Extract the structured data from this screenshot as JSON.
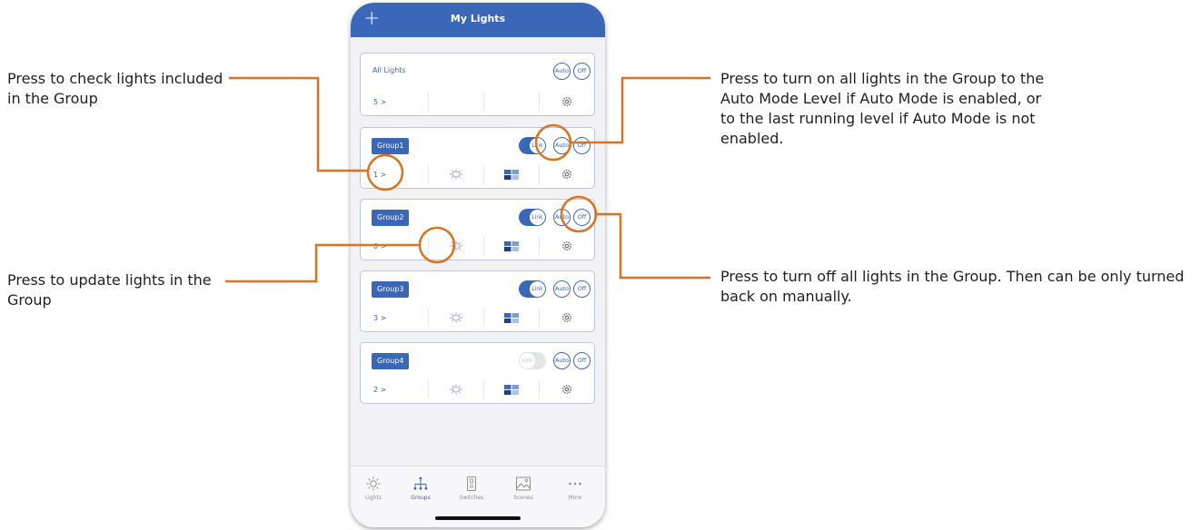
{
  "app": {
    "title": "My Lights",
    "add_icon": "plus-icon"
  },
  "all_lights": {
    "title": "All Lights",
    "count": "5 >",
    "auto_label": "Auto",
    "off_label": "Off"
  },
  "groups": [
    {
      "name": "Group1",
      "count": "1 >",
      "link_label": "Link",
      "link_on": true,
      "auto_label": "Auto",
      "off_label": "Off"
    },
    {
      "name": "Group2",
      "count": "0 >",
      "link_label": "Link",
      "link_on": true,
      "auto_label": "Auto",
      "off_label": "Off"
    },
    {
      "name": "Group3",
      "count": "3 >",
      "link_label": "Link",
      "link_on": true,
      "auto_label": "Auto",
      "off_label": "Off"
    },
    {
      "name": "Group4",
      "count": "2 >",
      "link_label": "Link",
      "link_on": false,
      "auto_label": "Auto",
      "off_label": "Off"
    }
  ],
  "tabs": [
    {
      "label": "Lights",
      "icon": "sun-icon",
      "active": false
    },
    {
      "label": "Groups",
      "icon": "groups-icon",
      "active": true
    },
    {
      "label": "Switches",
      "icon": "switch-icon",
      "active": false
    },
    {
      "label": "Scenes",
      "icon": "scenes-icon",
      "active": false
    },
    {
      "label": "More",
      "icon": "more-icon",
      "active": false
    }
  ],
  "annotations": {
    "check": "Press to check lights included in the Group",
    "update": "Press to update lights in the Group",
    "auto": "Press to turn on all lights in the Group to the Auto Mode Level if Auto Mode is enabled, or to the last running level if Auto Mode is not enabled.",
    "off": "Press to turn off all lights in the Group. Then can be only turned back on manually."
  },
  "colors": {
    "accent": "#3a67b8",
    "annotation": "#d9731e",
    "text": "#1f1f1f"
  }
}
